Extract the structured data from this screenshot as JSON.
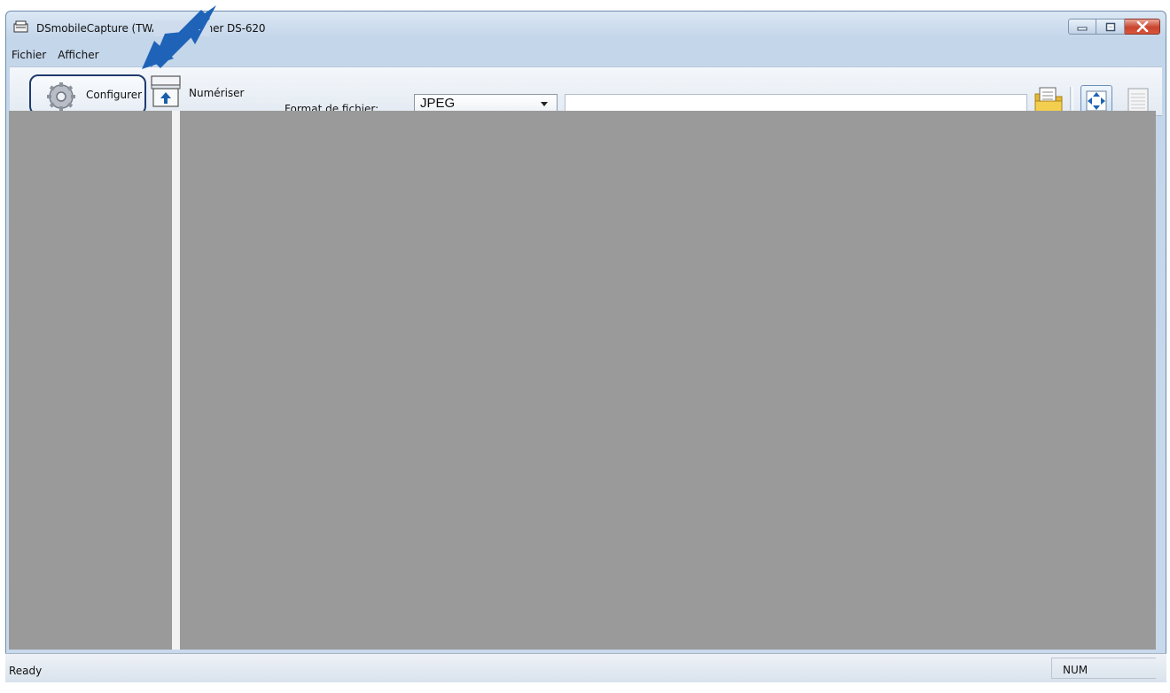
{
  "window": {
    "title": "DSmobileCapture (TWAIN) - Brother DS-620",
    "caption_buttons": [
      "minimize",
      "maximize",
      "close"
    ]
  },
  "menubar": {
    "items": [
      "Fichier",
      "Afficher"
    ]
  },
  "toolbar": {
    "configure_label": "Configurer",
    "scan_label": "Numériser",
    "format_label": "Format de fichier:",
    "format_value": "JPEG",
    "path_value": "",
    "icons": [
      "gear-icon",
      "scanner-icon",
      "folder-icon",
      "fit-view-icon",
      "page-view-icon"
    ]
  },
  "status": {
    "text": "Ready",
    "num": "NUM"
  },
  "colors": {
    "pane_background": "#9a9a9a",
    "highlight_border": "#1f3b6d",
    "callout_arrow": "#1f63b8"
  }
}
